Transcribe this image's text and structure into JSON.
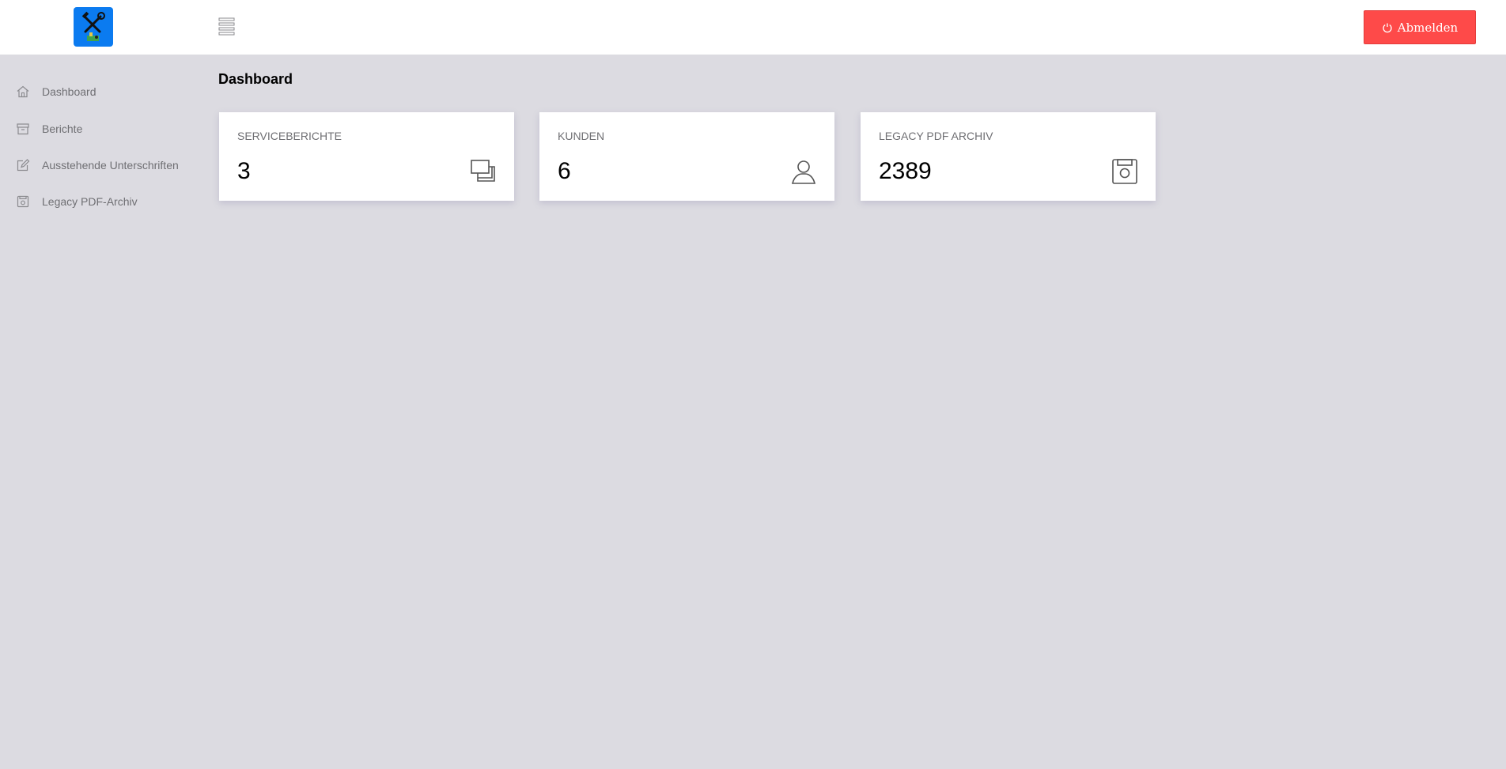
{
  "header": {
    "logout_label": "Abmelden",
    "logout_color": "#fe4a49",
    "logo_bg_color": "#0b7bf0"
  },
  "sidebar": {
    "items": [
      {
        "label": "Dashboard",
        "icon": "home-icon"
      },
      {
        "label": "Berichte",
        "icon": "archive-icon"
      },
      {
        "label": "Ausstehende Unterschriften",
        "icon": "edit-icon"
      },
      {
        "label": "Legacy PDF-Archiv",
        "icon": "save-icon"
      }
    ]
  },
  "main": {
    "title": "Dashboard",
    "cards": [
      {
        "label": "SERVICEBERICHTE",
        "value": "3",
        "icon": "copy-icon"
      },
      {
        "label": "KUNDEN",
        "value": "6",
        "icon": "user-icon"
      },
      {
        "label": "LEGACY PDF ARCHIV",
        "value": "2389",
        "icon": "save-icon"
      }
    ]
  }
}
